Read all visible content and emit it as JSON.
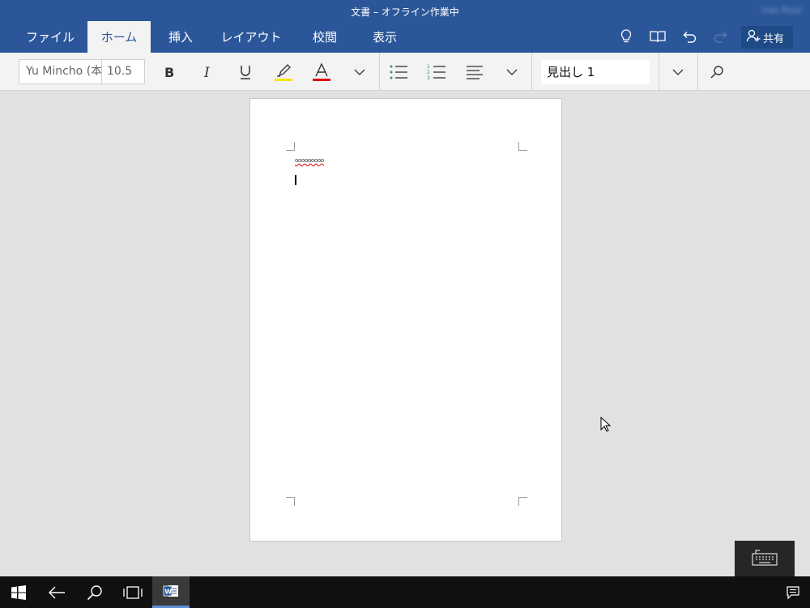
{
  "titlebar": {
    "title": "文書 – オフライン作業中",
    "user_name": "Udo Rout"
  },
  "tabs": [
    {
      "label": "ファイル",
      "active": false
    },
    {
      "label": "ホーム",
      "active": true
    },
    {
      "label": "挿入",
      "active": false
    },
    {
      "label": "レイアウト",
      "active": false
    },
    {
      "label": "校閲",
      "active": false
    },
    {
      "label": "表示",
      "active": false
    }
  ],
  "toolbar_right": {
    "share_label": "共有",
    "icons": [
      "lightbulb-icon",
      "read-mode-icon",
      "undo-icon",
      "redo-icon",
      "share-person-icon"
    ]
  },
  "ribbon": {
    "font_name": "Yu Mincho (本",
    "font_size": "10.5",
    "style_name": "見出し 1",
    "highlight_color": "#f5e600",
    "font_color": "#e00000"
  },
  "document": {
    "text": "ooooooooo"
  },
  "colors": {
    "brand": "#2b579a",
    "ribbon_bg": "#f3f3f3",
    "canvas_bg": "#e1e1e1",
    "taskbar_bg": "#101010",
    "list_accent": "#2f9a6b"
  },
  "taskbar": {
    "items": [
      "windows-start-icon",
      "back-arrow-icon",
      "search-icon",
      "task-view-icon",
      "word-app-icon",
      "action-center-icon"
    ]
  }
}
